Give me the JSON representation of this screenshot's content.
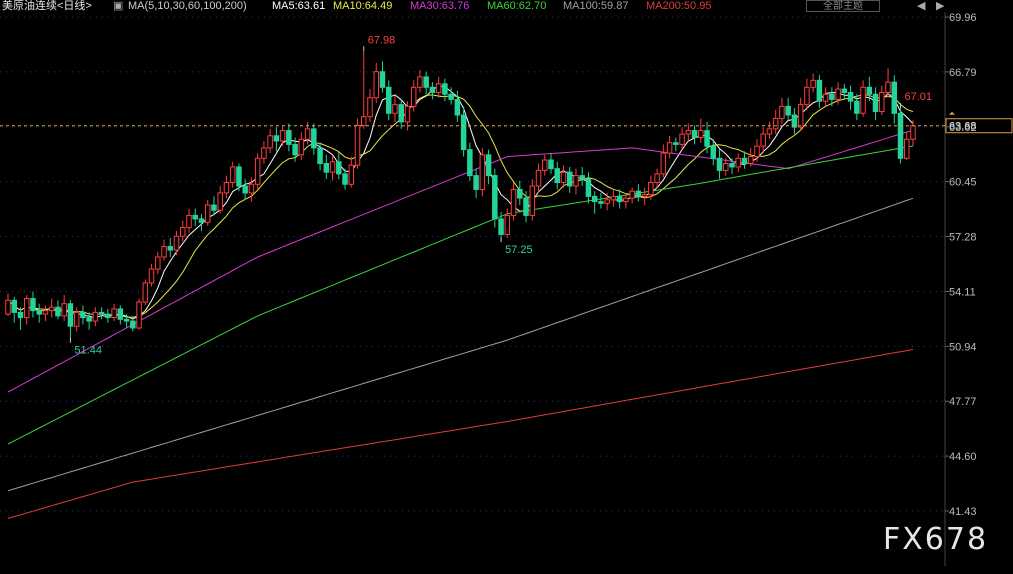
{
  "header": {
    "instrument": "美原油连续<日线>",
    "ma_params": "MA(5,10,30,60,100,200)",
    "ma_values": [
      {
        "label": "MA5:63.61",
        "color": "#ffffff"
      },
      {
        "label": "MA10:64.49",
        "color": "#e8e84a"
      },
      {
        "label": "MA30:63.76",
        "color": "#d23cd2"
      },
      {
        "label": "MA60:62.70",
        "color": "#3cd23c"
      },
      {
        "label": "MA100:59.87",
        "color": "#a0a0a0"
      },
      {
        "label": "MA200:50.95",
        "color": "#e03c3c"
      }
    ],
    "theme_button": "全部主题",
    "prev_icon": "triangle-left",
    "next_icon": "triangle-right"
  },
  "watermark": "FX678",
  "colors": {
    "up": "#ff3c3c",
    "down": "#22d49a",
    "grid": "#1e3c8c",
    "axis_text": "#bbbbbb",
    "price_line": "#e0a040",
    "high_label": "#ff4040",
    "low_label": "#30d0a0"
  },
  "chart_data": {
    "type": "candlestick",
    "y_ticks": [
      "69.96",
      "66.79",
      "63.62",
      "60.45",
      "57.28",
      "54.11",
      "50.94",
      "47.77",
      "44.60",
      "41.43"
    ],
    "ylim": [
      41.43,
      69.96
    ],
    "current_price": "63.68",
    "annotations": [
      {
        "text": "67.98",
        "kind": "high",
        "index": 57
      },
      {
        "text": "57.25",
        "kind": "low",
        "index": 79
      },
      {
        "text": "51.44",
        "kind": "low",
        "index": 10
      },
      {
        "text": "67.01",
        "kind": "high",
        "index": 143
      }
    ],
    "candles": [
      [
        52.8,
        53.6,
        54.0,
        52.7
      ],
      [
        53.6,
        52.9,
        53.8,
        52.3
      ],
      [
        52.9,
        52.6,
        53.2,
        51.9
      ],
      [
        52.6,
        53.7,
        53.9,
        52.2
      ],
      [
        53.7,
        53.0,
        54.1,
        52.6
      ],
      [
        53.0,
        52.8,
        53.4,
        52.3
      ],
      [
        52.8,
        53.0,
        53.3,
        52.4
      ],
      [
        53.0,
        53.2,
        53.7,
        52.6
      ],
      [
        53.2,
        52.7,
        53.6,
        52.5
      ],
      [
        52.7,
        53.4,
        53.9,
        52.4
      ],
      [
        53.4,
        52.1,
        53.6,
        51.44
      ],
      [
        52.1,
        52.9,
        53.2,
        51.8
      ],
      [
        52.9,
        52.6,
        53.3,
        52.2
      ],
      [
        52.6,
        52.4,
        52.9,
        51.9
      ],
      [
        52.4,
        52.9,
        53.2,
        52.1
      ],
      [
        52.9,
        52.8,
        53.2,
        52.5
      ],
      [
        52.8,
        52.6,
        53.1,
        52.3
      ],
      [
        52.6,
        53.1,
        53.4,
        52.4
      ],
      [
        53.1,
        52.5,
        53.3,
        52.2
      ],
      [
        52.5,
        52.4,
        52.8,
        52.0
      ],
      [
        52.4,
        52.0,
        52.7,
        51.8
      ],
      [
        52.0,
        53.5,
        53.7,
        51.9
      ],
      [
        53.5,
        54.6,
        54.8,
        53.3
      ],
      [
        54.6,
        55.4,
        55.7,
        54.4
      ],
      [
        55.4,
        56.1,
        56.4,
        55.1
      ],
      [
        56.1,
        56.7,
        57.1,
        55.9
      ],
      [
        56.7,
        56.5,
        57.2,
        56.1
      ],
      [
        56.5,
        57.3,
        57.6,
        56.2
      ],
      [
        57.3,
        57.8,
        58.2,
        57.0
      ],
      [
        57.8,
        58.5,
        58.9,
        57.5
      ],
      [
        58.5,
        58.3,
        58.9,
        57.9
      ],
      [
        58.3,
        58.1,
        58.6,
        57.6
      ],
      [
        58.1,
        59.1,
        59.4,
        57.9
      ],
      [
        59.1,
        58.8,
        59.6,
        58.5
      ],
      [
        58.8,
        59.8,
        60.2,
        58.6
      ],
      [
        59.8,
        60.4,
        60.8,
        59.5
      ],
      [
        60.4,
        61.3,
        61.6,
        60.1
      ],
      [
        61.3,
        60.2,
        61.5,
        59.9
      ],
      [
        60.2,
        59.8,
        60.6,
        59.4
      ],
      [
        59.8,
        60.3,
        60.7,
        59.3
      ],
      [
        60.3,
        61.8,
        62.1,
        60.0
      ],
      [
        61.8,
        62.4,
        62.8,
        61.5
      ],
      [
        62.4,
        63.1,
        63.5,
        62.1
      ],
      [
        63.1,
        62.8,
        63.6,
        62.2
      ],
      [
        62.8,
        63.4,
        63.7,
        62.5
      ],
      [
        63.4,
        62.6,
        63.8,
        62.2
      ],
      [
        62.6,
        62.0,
        63.0,
        61.6
      ],
      [
        62.0,
        62.9,
        63.3,
        61.7
      ],
      [
        62.9,
        63.5,
        63.9,
        62.6
      ],
      [
        63.5,
        62.4,
        63.8,
        62.0
      ],
      [
        62.4,
        61.5,
        62.7,
        61.1
      ],
      [
        61.5,
        61.0,
        62.0,
        60.6
      ],
      [
        61.0,
        61.6,
        62.0,
        60.5
      ],
      [
        61.6,
        60.9,
        62.2,
        60.6
      ],
      [
        60.9,
        60.3,
        61.2,
        60.0
      ],
      [
        60.3,
        61.4,
        61.9,
        60.1
      ],
      [
        61.4,
        63.7,
        64.1,
        61.2
      ],
      [
        63.7,
        64.2,
        67.98,
        63.5
      ],
      [
        64.2,
        65.3,
        65.8,
        63.9
      ],
      [
        65.3,
        66.8,
        67.3,
        65.0
      ],
      [
        66.8,
        65.9,
        67.4,
        65.6
      ],
      [
        65.9,
        64.4,
        66.3,
        64.0
      ],
      [
        64.4,
        64.9,
        65.4,
        63.9
      ],
      [
        64.9,
        63.9,
        65.2,
        63.5
      ],
      [
        63.9,
        64.8,
        65.1,
        63.4
      ],
      [
        64.8,
        65.9,
        66.3,
        64.5
      ],
      [
        65.9,
        66.5,
        66.9,
        65.6
      ],
      [
        66.5,
        65.9,
        66.8,
        65.5
      ],
      [
        65.9,
        65.6,
        66.2,
        65.2
      ],
      [
        65.6,
        66.1,
        66.5,
        65.3
      ],
      [
        66.1,
        65.5,
        66.4,
        65.1
      ],
      [
        65.5,
        65.2,
        65.9,
        64.9
      ],
      [
        65.2,
        64.3,
        65.7,
        63.9
      ],
      [
        64.3,
        62.3,
        64.8,
        61.9
      ],
      [
        62.3,
        60.8,
        62.7,
        60.5
      ],
      [
        60.8,
        60.0,
        61.2,
        59.5
      ],
      [
        60.0,
        62.0,
        62.4,
        59.6
      ],
      [
        62.0,
        60.8,
        62.3,
        60.3
      ],
      [
        60.8,
        58.3,
        61.2,
        57.8
      ],
      [
        58.3,
        57.4,
        58.7,
        57.25
      ],
      [
        57.4,
        58.5,
        58.9,
        57.2
      ],
      [
        58.5,
        60.0,
        60.4,
        58.2
      ],
      [
        60.0,
        59.5,
        60.5,
        59.1
      ],
      [
        59.5,
        58.5,
        59.9,
        58.1
      ],
      [
        58.5,
        60.2,
        60.6,
        58.2
      ],
      [
        60.2,
        61.1,
        61.5,
        59.8
      ],
      [
        61.1,
        61.7,
        62.0,
        60.8
      ],
      [
        61.7,
        61.2,
        62.1,
        60.9
      ],
      [
        61.2,
        60.4,
        61.6,
        60.0
      ],
      [
        60.4,
        61.0,
        61.4,
        60.1
      ],
      [
        61.0,
        60.2,
        61.3,
        59.8
      ],
      [
        60.2,
        60.8,
        61.2,
        59.7
      ],
      [
        60.8,
        60.6,
        61.3,
        60.2
      ],
      [
        60.6,
        59.6,
        61.0,
        59.2
      ],
      [
        59.6,
        59.3,
        59.9,
        58.6
      ],
      [
        59.3,
        59.2,
        59.8,
        58.9
      ],
      [
        59.2,
        59.4,
        59.8,
        58.8
      ],
      [
        59.4,
        59.6,
        60.0,
        59.0
      ],
      [
        59.6,
        59.3,
        60.0,
        58.9
      ],
      [
        59.3,
        59.5,
        59.8,
        58.9
      ],
      [
        59.5,
        59.9,
        60.1,
        59.2
      ],
      [
        59.9,
        59.6,
        60.3,
        59.3
      ],
      [
        59.6,
        59.7,
        60.1,
        59.1
      ],
      [
        59.7,
        60.4,
        60.8,
        59.4
      ],
      [
        60.4,
        60.9,
        61.2,
        60.1
      ],
      [
        60.9,
        62.1,
        62.6,
        60.7
      ],
      [
        62.1,
        62.7,
        63.1,
        61.8
      ],
      [
        62.7,
        62.6,
        63.0,
        62.2
      ],
      [
        62.6,
        63.2,
        63.6,
        62.3
      ],
      [
        63.2,
        63.4,
        63.8,
        62.8
      ],
      [
        63.4,
        63.0,
        63.7,
        62.6
      ],
      [
        63.0,
        63.4,
        64.1,
        62.7
      ],
      [
        63.4,
        62.5,
        63.9,
        62.1
      ],
      [
        62.5,
        61.8,
        62.9,
        61.4
      ],
      [
        61.8,
        61.1,
        62.3,
        60.6
      ],
      [
        61.1,
        61.5,
        61.8,
        60.8
      ],
      [
        61.5,
        61.3,
        61.8,
        60.9
      ],
      [
        61.3,
        61.8,
        62.1,
        61.0
      ],
      [
        61.8,
        61.5,
        62.2,
        61.2
      ],
      [
        61.5,
        61.9,
        62.4,
        61.3
      ],
      [
        61.9,
        62.5,
        62.9,
        61.6
      ],
      [
        62.5,
        63.2,
        63.6,
        62.1
      ],
      [
        63.2,
        63.5,
        63.9,
        62.9
      ],
      [
        63.5,
        64.1,
        64.6,
        63.2
      ],
      [
        64.1,
        64.8,
        65.3,
        63.8
      ],
      [
        64.8,
        64.3,
        65.3,
        64.0
      ],
      [
        64.3,
        63.6,
        64.7,
        63.2
      ],
      [
        63.6,
        64.9,
        65.3,
        63.4
      ],
      [
        64.9,
        65.9,
        66.4,
        64.6
      ],
      [
        65.9,
        66.3,
        66.7,
        65.6
      ],
      [
        66.3,
        65.1,
        66.6,
        64.7
      ],
      [
        65.1,
        65.5,
        65.9,
        64.8
      ],
      [
        65.5,
        65.2,
        65.9,
        64.8
      ],
      [
        65.2,
        65.8,
        66.2,
        64.9
      ],
      [
        65.8,
        65.6,
        66.1,
        65.2
      ],
      [
        65.6,
        65.1,
        66.0,
        64.6
      ],
      [
        65.1,
        64.4,
        65.5,
        64.0
      ],
      [
        64.4,
        65.9,
        66.3,
        64.2
      ],
      [
        65.9,
        65.5,
        66.5,
        65.1
      ],
      [
        65.5,
        64.5,
        65.9,
        64.0
      ],
      [
        64.5,
        65.6,
        66.0,
        64.3
      ],
      [
        65.6,
        66.2,
        67.01,
        65.3
      ],
      [
        66.2,
        64.4,
        66.6,
        63.8
      ],
      [
        64.4,
        61.8,
        64.7,
        61.5
      ],
      [
        61.8,
        62.9,
        63.3,
        61.7
      ],
      [
        62.9,
        63.68,
        64.0,
        62.5
      ]
    ],
    "moving_averages": [
      {
        "name": "MA5",
        "color": "#ffffff",
        "width": 1.0
      },
      {
        "name": "MA10",
        "color": "#e8e84a",
        "width": 1.0
      },
      {
        "name": "MA30",
        "color": "#d23cd2",
        "width": 1.0
      },
      {
        "name": "MA60",
        "color": "#3cd23c",
        "width": 1.0
      },
      {
        "name": "MA100",
        "color": "#a0a0a0",
        "width": 1.0
      },
      {
        "name": "MA200",
        "color": "#e03c3c",
        "width": 1.0
      }
    ],
    "ma_endpoints": {
      "MA30": [
        [
          0,
          48.3
        ],
        [
          40,
          56.1
        ],
        [
          80,
          61.9
        ],
        [
          100,
          62.4
        ],
        [
          125,
          61.2
        ],
        [
          148,
          63.76
        ]
      ],
      "MA60": [
        [
          0,
          45.3
        ],
        [
          40,
          52.7
        ],
        [
          80,
          58.6
        ],
        [
          110,
          60.3
        ],
        [
          148,
          62.7
        ]
      ],
      "MA100": [
        [
          0,
          42.6
        ],
        [
          80,
          51.3
        ],
        [
          148,
          59.87
        ]
      ],
      "MA200": [
        [
          0,
          41.0
        ],
        [
          20,
          43.1
        ],
        [
          80,
          46.6
        ],
        [
          148,
          50.95
        ]
      ]
    },
    "grid": true
  }
}
